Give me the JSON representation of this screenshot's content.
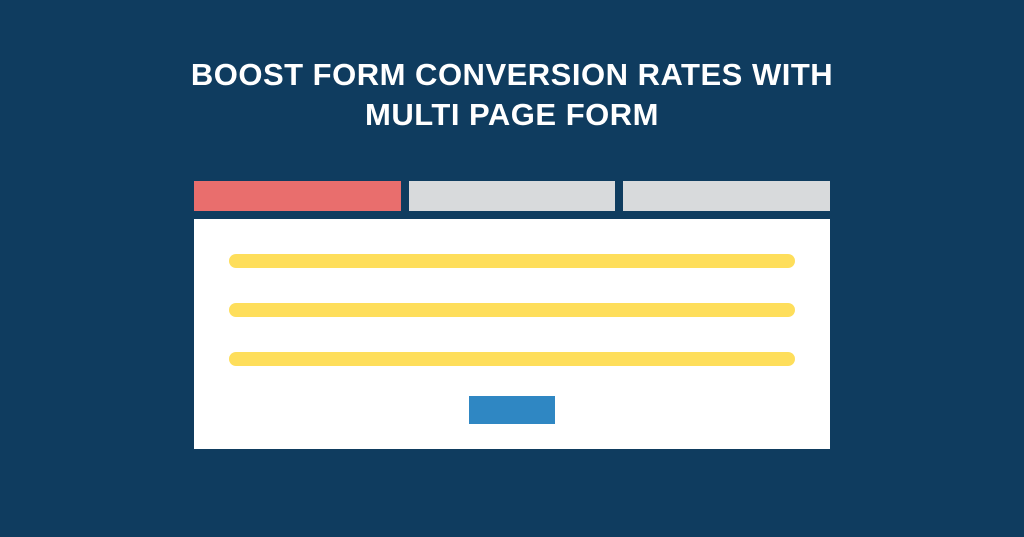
{
  "heading": {
    "line1": "BOOST FORM CONVERSION RATES WITH",
    "line2": "MULTI PAGE FORM"
  },
  "colors": {
    "background": "#0f3c5f",
    "step_active": "#e96e6d",
    "step_inactive": "#d8dadc",
    "field": "#fede5b",
    "button": "#2f87c3",
    "card": "#ffffff"
  },
  "steps": {
    "total": 3,
    "active_index": 0
  }
}
